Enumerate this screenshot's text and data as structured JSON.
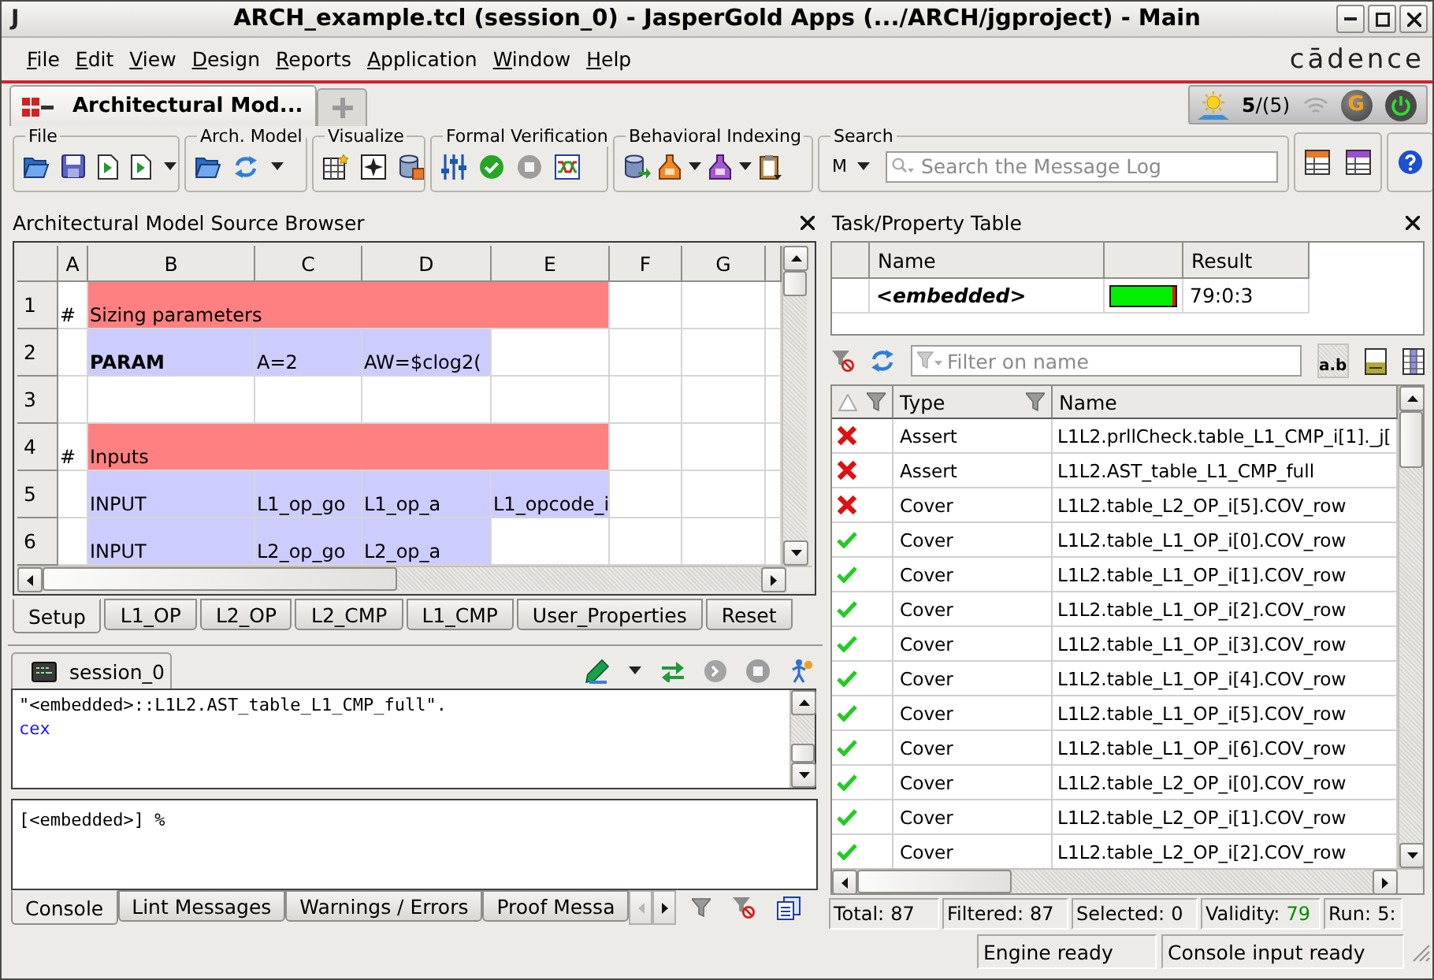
{
  "window": {
    "app_icon": "J",
    "title": "ARCH_example.tcl (session_0) - JasperGold Apps (.../ARCH/jgproject) - Main"
  },
  "menu": [
    "File",
    "Edit",
    "View",
    "Design",
    "Reports",
    "Application",
    "Window",
    "Help"
  ],
  "brand": "cādence",
  "tabs": [
    {
      "label": "Architectural Mod...",
      "selected": true
    }
  ],
  "status_widget": {
    "counter": "**5**/(5)",
    "engine_badge": "G"
  },
  "toolbar": {
    "groups": [
      {
        "label": "File"
      },
      {
        "label": "Arch. Model"
      },
      {
        "label": "Visualize"
      },
      {
        "label": "Formal Verification"
      },
      {
        "label": "Behavioral Indexing"
      }
    ],
    "search": {
      "label": "Search",
      "mode": "M",
      "placeholder": "Search the Message Log"
    }
  },
  "source_browser": {
    "title": "Architectural Model Source Browser",
    "columns": [
      "A",
      "B",
      "C",
      "D",
      "E",
      "F",
      "G"
    ],
    "rows": [
      {
        "number": "1",
        "kind": "section",
        "marker": "#",
        "text": "Sizing parameters",
        "color": "#ff8080"
      },
      {
        "number": "2",
        "kind": "entries",
        "cells": [
          {
            "text": "PARAM",
            "bold": true,
            "color": "#ccccff"
          },
          {
            "text": "A=2",
            "bold": false,
            "color": "#ccccff"
          },
          {
            "text": "AW=$clog2(",
            "bold": false,
            "color": "#ccccff"
          }
        ]
      },
      {
        "number": "3",
        "kind": "blank"
      },
      {
        "number": "4",
        "kind": "section",
        "marker": "#",
        "text": "Inputs",
        "color": "#ff8080"
      },
      {
        "number": "5",
        "kind": "entries",
        "cells": [
          {
            "text": "INPUT",
            "bold": false,
            "color": "#ccccff"
          },
          {
            "text": "L1_op_go",
            "bold": false,
            "color": "#ccccff"
          },
          {
            "text": "L1_op_a",
            "bold": false,
            "color": "#ccccff"
          },
          {
            "text": "L1_opcode_i",
            "bold": false,
            "color": "#ccccff"
          }
        ]
      },
      {
        "number": "6",
        "kind": "entries",
        "cells": [
          {
            "text": "INPUT",
            "bold": false,
            "color": "#ccccff"
          },
          {
            "text": "L2_op_go",
            "bold": false,
            "color": "#ccccff"
          },
          {
            "text": "L2_op_a",
            "bold": false,
            "color": "#ccccff"
          }
        ]
      }
    ],
    "sheet_tabs": [
      {
        "label": "Setup",
        "selected": true
      },
      {
        "label": "L1_OP",
        "selected": false
      },
      {
        "label": "L2_OP",
        "selected": false
      },
      {
        "label": "L2_CMP",
        "selected": false
      },
      {
        "label": "L1_CMP",
        "selected": false
      },
      {
        "label": "User_Properties",
        "selected": false
      },
      {
        "label": "Reset",
        "selected": false
      }
    ]
  },
  "console": {
    "tab": "session_0",
    "output": [
      {
        "kind": "message",
        "text": "\"<embedded>::L1L2.AST_table_L1_CMP_full\"."
      },
      {
        "kind": "command",
        "text": "cex"
      }
    ],
    "prompt": "[<embedded>] %",
    "tabs": [
      {
        "label": "Console",
        "selected": true
      },
      {
        "label": "Lint Messages",
        "selected": false
      },
      {
        "label": "Warnings / Errors",
        "selected": false
      },
      {
        "label": "Proof Messa",
        "selected": false
      }
    ],
    "tab_scroll": {
      "back_disabled": true,
      "forward_disabled": false
    }
  },
  "task_table": {
    "title": "Task/Property Table",
    "columns": {
      "name": "Name",
      "result": "Result"
    },
    "rows": [
      {
        "name": "<embedded>",
        "level": 0.95,
        "result": "79:0:3"
      }
    ]
  },
  "filter": {
    "placeholder": "Filter on name",
    "match_toggle": {
      "label": "a.b",
      "checked": true
    }
  },
  "property_table": {
    "columns": {
      "type": "Type",
      "name": "Name"
    },
    "rows": [
      {
        "passed": false,
        "type": "Assert",
        "name": "L1L2.prllCheck.table_L1_CMP_i[1]._j["
      },
      {
        "passed": false,
        "type": "Assert",
        "name": "L1L2.AST_table_L1_CMP_full"
      },
      {
        "passed": false,
        "type": "Cover",
        "name": "L1L2.table_L2_OP_i[5].COV_row"
      },
      {
        "passed": true,
        "type": "Cover",
        "name": "L1L2.table_L1_OP_i[0].COV_row"
      },
      {
        "passed": true,
        "type": "Cover",
        "name": "L1L2.table_L1_OP_i[1].COV_row"
      },
      {
        "passed": true,
        "type": "Cover",
        "name": "L1L2.table_L1_OP_i[2].COV_row"
      },
      {
        "passed": true,
        "type": "Cover",
        "name": "L1L2.table_L1_OP_i[3].COV_row"
      },
      {
        "passed": true,
        "type": "Cover",
        "name": "L1L2.table_L1_OP_i[4].COV_row"
      },
      {
        "passed": true,
        "type": "Cover",
        "name": "L1L2.table_L1_OP_i[5].COV_row"
      },
      {
        "passed": true,
        "type": "Cover",
        "name": "L1L2.table_L1_OP_i[6].COV_row"
      },
      {
        "passed": true,
        "type": "Cover",
        "name": "L1L2.table_L2_OP_i[0].COV_row"
      },
      {
        "passed": true,
        "type": "Cover",
        "name": "L1L2.table_L2_OP_i[1].COV_row"
      },
      {
        "passed": true,
        "type": "Cover",
        "name": "L1L2.table_L2_OP_i[2].COV_row"
      }
    ],
    "stats": [
      {
        "label": "Total:",
        "value": "87",
        "color": "#000000"
      },
      {
        "label": "Filtered:",
        "value": "87",
        "color": "#000000"
      },
      {
        "label": "Selected:",
        "value": "0",
        "color": "#000000"
      },
      {
        "label": "Validity:",
        "value": "79",
        "color": "#008c00"
      },
      {
        "label": "Run:",
        "value": "5:",
        "color": "#000000"
      }
    ]
  },
  "status_bar": [
    "Engine ready",
    "Console input ready"
  ]
}
